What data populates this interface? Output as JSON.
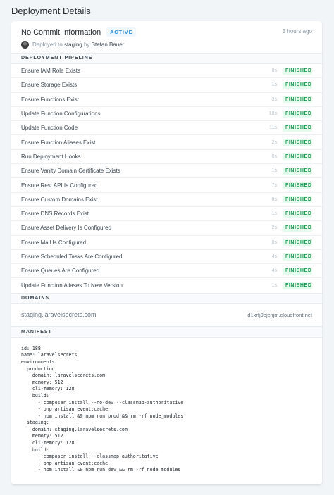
{
  "page": {
    "title": "Deployment Details"
  },
  "deployment": {
    "commit_title": "No Commit Information",
    "status_badge": "ACTIVE",
    "time_ago": "3 hours ago",
    "deployed_prefix": "Deployed to",
    "environment": "staging",
    "by_word": "by",
    "author": "Stefan Bauer"
  },
  "pipeline": {
    "heading": "DEPLOYMENT PIPELINE",
    "steps": [
      {
        "name": "Ensure IAM Role Exists",
        "duration": "0s",
        "status": "FINISHED"
      },
      {
        "name": "Ensure Storage Exists",
        "duration": "1s",
        "status": "FINISHED"
      },
      {
        "name": "Ensure Functions Exist",
        "duration": "3s",
        "status": "FINISHED"
      },
      {
        "name": "Update Function Configurations",
        "duration": "18s",
        "status": "FINISHED"
      },
      {
        "name": "Update Function Code",
        "duration": "11s",
        "status": "FINISHED"
      },
      {
        "name": "Ensure Function Aliases Exist",
        "duration": "2s",
        "status": "FINISHED"
      },
      {
        "name": "Run Deployment Hooks",
        "duration": "0s",
        "status": "FINISHED"
      },
      {
        "name": "Ensure Vanity Domain Certificate Exists",
        "duration": "1s",
        "status": "FINISHED"
      },
      {
        "name": "Ensure Rest API Is Configured",
        "duration": "7s",
        "status": "FINISHED"
      },
      {
        "name": "Ensure Custom Domains Exist",
        "duration": "8s",
        "status": "FINISHED"
      },
      {
        "name": "Ensure DNS Records Exist",
        "duration": "1s",
        "status": "FINISHED"
      },
      {
        "name": "Ensure Asset Delivery Is Configured",
        "duration": "2s",
        "status": "FINISHED"
      },
      {
        "name": "Ensure Mail Is Configured",
        "duration": "0s",
        "status": "FINISHED"
      },
      {
        "name": "Ensure Scheduled Tasks Are Configured",
        "duration": "4s",
        "status": "FINISHED"
      },
      {
        "name": "Ensure Queues Are Configured",
        "duration": "4s",
        "status": "FINISHED"
      },
      {
        "name": "Update Function Aliases To New Version",
        "duration": "1s",
        "status": "FINISHED"
      }
    ]
  },
  "domains": {
    "heading": "DOMAINS",
    "name": "staging.laravelsecrets.com",
    "target": "d1xrfj9ejcnjm.cloudfront.net"
  },
  "manifest": {
    "heading": "MANIFEST",
    "content": "id: 188\nname: laravelsecrets\nenvironments:\n  production:\n    domain: laravelsecrets.com\n    memory: 512\n    cli-memory: 128\n    build:\n      - composer install --no-dev --classmap-authoritative\n      - php artisan event:cache\n      - npm install && npm run prod && rm -rf node_modules\n  staging:\n    domain: staging.laravelsecrets.com\n    memory: 512\n    cli-memory: 128\n    build:\n      - composer install --classmap-authoritative\n      - php artisan event:cache\n      - npm install && npm run dev && rm -rf node_modules"
  },
  "colors": {
    "page_bg": "#f1f5f8",
    "finished_text": "#1f9d55",
    "finished_bg": "#e3fcec",
    "active_text": "#3490dc",
    "active_bg": "#eff8ff"
  },
  "icons": {
    "avatar": "user-avatar-photo"
  }
}
